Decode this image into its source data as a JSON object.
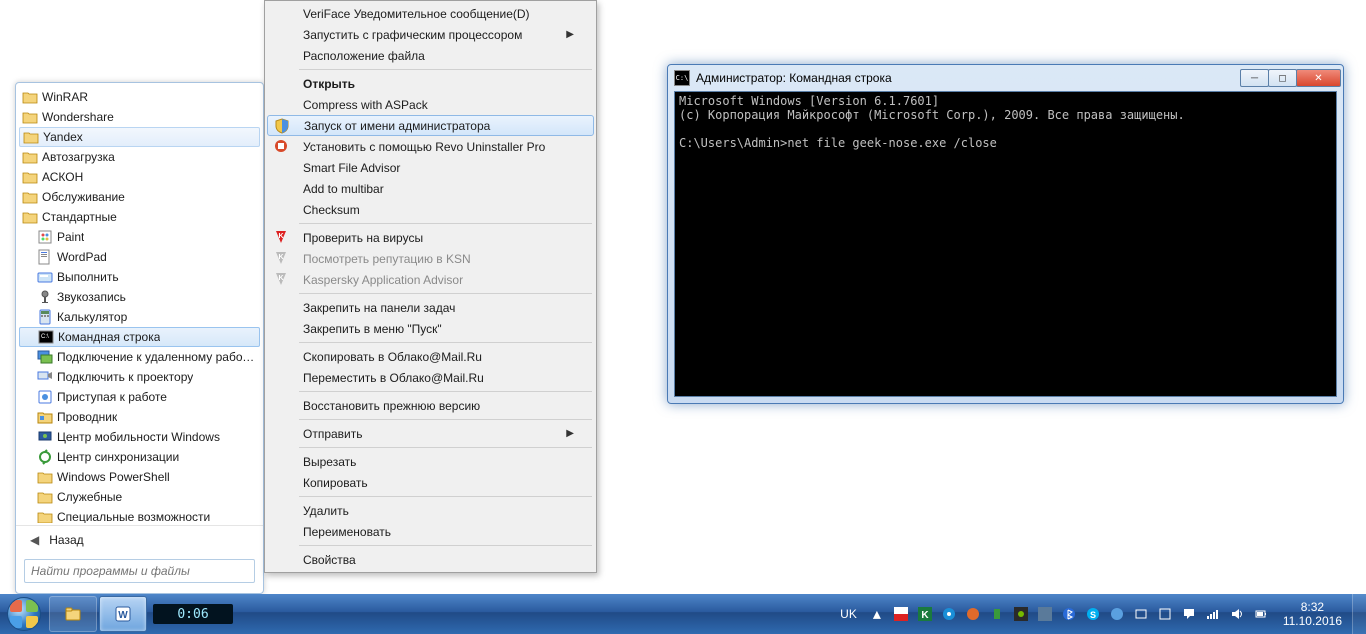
{
  "start_menu": {
    "items": [
      {
        "label": "WinRAR",
        "icon": "folder",
        "indent": 0
      },
      {
        "label": "Wondershare",
        "icon": "folder",
        "indent": 0
      },
      {
        "label": "Yandex",
        "icon": "folder",
        "indent": 0,
        "state": "hovered"
      },
      {
        "label": "Автозагрузка",
        "icon": "folder",
        "indent": 0
      },
      {
        "label": "АСКОН",
        "icon": "folder",
        "indent": 0
      },
      {
        "label": "Обслуживание",
        "icon": "folder",
        "indent": 0
      },
      {
        "label": "Стандартные",
        "icon": "folder-open",
        "indent": 0
      },
      {
        "label": "Paint",
        "icon": "paint",
        "indent": 1
      },
      {
        "label": "WordPad",
        "icon": "wordpad",
        "indent": 1
      },
      {
        "label": "Выполнить",
        "icon": "run",
        "indent": 1
      },
      {
        "label": "Звукозапись",
        "icon": "sound",
        "indent": 1
      },
      {
        "label": "Калькулятор",
        "icon": "calc",
        "indent": 1
      },
      {
        "label": "Командная строка",
        "icon": "cmd",
        "indent": 1,
        "state": "selected"
      },
      {
        "label": "Подключение к удаленному рабочему",
        "icon": "rdp",
        "indent": 1
      },
      {
        "label": "Подключить к проектору",
        "icon": "projector",
        "indent": 1
      },
      {
        "label": "Приступая к работе",
        "icon": "getting-started",
        "indent": 1
      },
      {
        "label": "Проводник",
        "icon": "explorer",
        "indent": 1
      },
      {
        "label": "Центр мобильности Windows",
        "icon": "mobility",
        "indent": 1
      },
      {
        "label": "Центр синхронизации",
        "icon": "sync",
        "indent": 1
      },
      {
        "label": "Windows PowerShell",
        "icon": "folder",
        "indent": 1
      },
      {
        "label": "Служебные",
        "icon": "folder",
        "indent": 1
      },
      {
        "label": "Специальные возможности",
        "icon": "folder",
        "indent": 1
      }
    ],
    "back_label": "Назад",
    "search_placeholder": "Найти программы и файлы"
  },
  "context_menu": {
    "groups": [
      [
        {
          "label": "VeriFace Уведомительное сообщение(D)"
        },
        {
          "label": "Запустить с графическим процессором",
          "submenu": true
        },
        {
          "label": "Расположение файла"
        }
      ],
      [
        {
          "label": "Открыть",
          "bold": true
        },
        {
          "label": "Compress with ASPack"
        },
        {
          "label": "Запуск от имени администратора",
          "icon": "shield",
          "selected": true
        },
        {
          "label": "Установить с помощью Revo Uninstaller Pro",
          "icon": "revo"
        },
        {
          "label": "Smart File Advisor"
        },
        {
          "label": "Add to multibar"
        },
        {
          "label": "Checksum"
        }
      ],
      [
        {
          "label": "Проверить на вирусы",
          "icon": "kaspersky"
        },
        {
          "label": "Посмотреть репутацию в KSN",
          "icon": "kaspersky-gray",
          "gray": true
        },
        {
          "label": "Kaspersky Application Advisor",
          "icon": "kaspersky-gray",
          "gray": true
        }
      ],
      [
        {
          "label": "Закрепить на панели задач"
        },
        {
          "label": "Закрепить в меню \"Пуск\""
        }
      ],
      [
        {
          "label": "Скопировать в Облако@Mail.Ru"
        },
        {
          "label": "Переместить в Облако@Mail.Ru"
        }
      ],
      [
        {
          "label": "Восстановить прежнюю версию"
        }
      ],
      [
        {
          "label": "Отправить",
          "submenu": true
        }
      ],
      [
        {
          "label": "Вырезать"
        },
        {
          "label": "Копировать"
        }
      ],
      [
        {
          "label": "Удалить"
        },
        {
          "label": "Переименовать"
        }
      ],
      [
        {
          "label": "Свойства"
        }
      ]
    ]
  },
  "cmd_window": {
    "title": "Администратор: Командная строка",
    "lines": [
      "Microsoft Windows [Version 6.1.7601]",
      "(c) Корпорация Майкрософт (Microsoft Corp.), 2009. Все права защищены.",
      "",
      "C:\\Users\\Admin>net file geek-nose.exe /close"
    ]
  },
  "taskbar": {
    "timer": "0:06",
    "lang": "UK",
    "clock_time": "8:32",
    "clock_date": "11.10.2016"
  }
}
